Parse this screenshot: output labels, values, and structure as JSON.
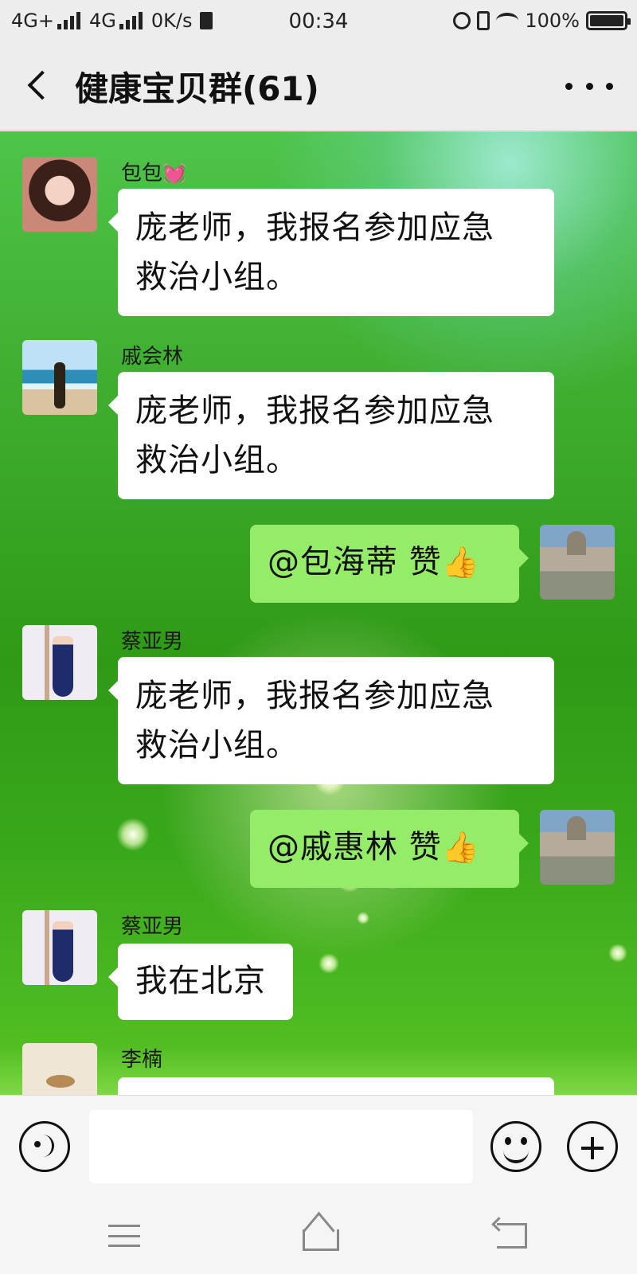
{
  "status_bar": {
    "network1": "4G+",
    "network2": "4G",
    "speed": "0K/s",
    "time": "00:34",
    "battery": "100%"
  },
  "header": {
    "title": "健康宝贝群(61)"
  },
  "messages": [
    {
      "sender": "包包",
      "text_line1": "庞老师，我报名参加应急",
      "text_line2": "救治小组。",
      "direction": "in"
    },
    {
      "sender": "戚会林",
      "text_line1": "庞老师，我报名参加应急",
      "text_line2": "救治小组。",
      "direction": "in"
    },
    {
      "sender": "",
      "text": "@包海蒂  赞",
      "emoji": "👍",
      "direction": "out"
    },
    {
      "sender": "蔡亚男",
      "text_line1": "庞老师，我报名参加应急",
      "text_line2": "救治小组。",
      "direction": "in"
    },
    {
      "sender": "",
      "text": "@戚惠林  赞",
      "emoji": "👍",
      "direction": "out"
    },
    {
      "sender": "蔡亚男",
      "text": "我在北京",
      "direction": "in"
    },
    {
      "sender": "李楠",
      "text": "",
      "direction": "in"
    }
  ],
  "colors": {
    "out_bubble": "#95ec69",
    "in_bubble": "#ffffff",
    "header_bg": "#ededed"
  },
  "icons": {
    "back": "chevron-left-icon",
    "more": "more-dots-icon",
    "voice": "voice-icon",
    "emoji": "emoji-icon",
    "plus": "plus-icon"
  }
}
